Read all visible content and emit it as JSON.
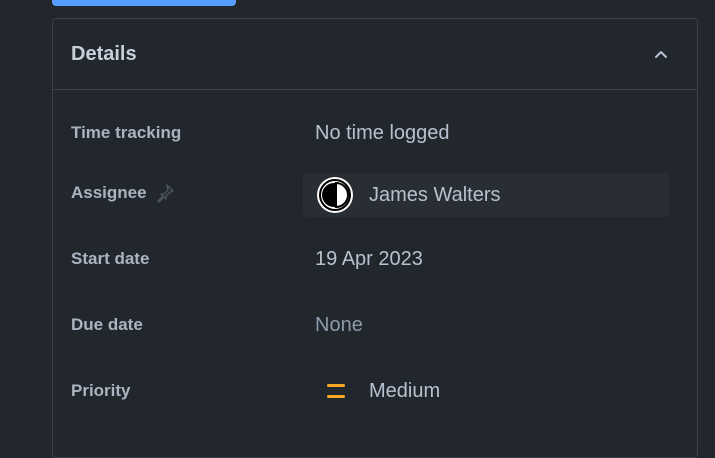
{
  "details": {
    "title": "Details",
    "time_tracking": {
      "label": "Time tracking",
      "value": "No time logged"
    },
    "assignee": {
      "label": "Assignee",
      "name": "James Walters",
      "pin_icon": "pin-icon",
      "avatar_icon": "avatar"
    },
    "start_date": {
      "label": "Start date",
      "value": "19 Apr 2023"
    },
    "due_date": {
      "label": "Due date",
      "value": "None"
    },
    "priority": {
      "label": "Priority",
      "value": "Medium",
      "icon": "medium-priority-icon",
      "color": "#f5a623"
    }
  },
  "colors": {
    "background": "#22272e",
    "border": "#3a414a",
    "accent": "#579dff"
  }
}
